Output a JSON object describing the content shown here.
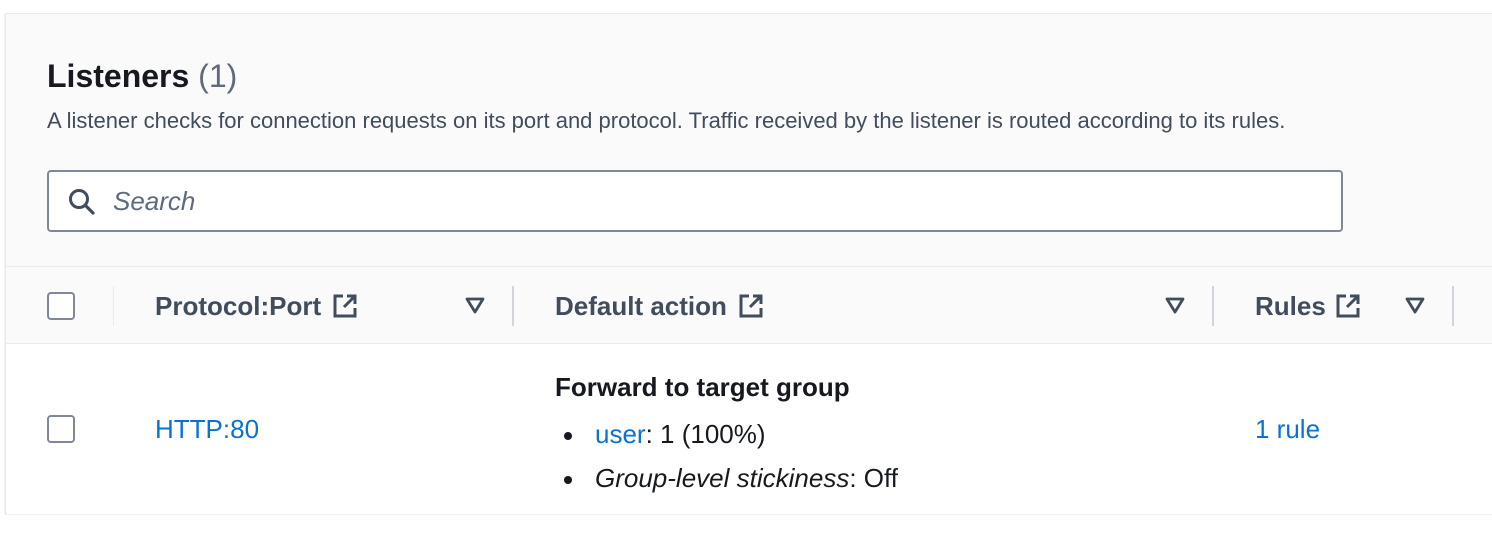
{
  "header": {
    "title": "Listeners",
    "count": "(1)",
    "description": "A listener checks for connection requests on its port and protocol. Traffic received by the listener is routed according to its rules."
  },
  "search": {
    "placeholder": "Search",
    "value": ""
  },
  "columns": [
    {
      "label": "Protocol:Port",
      "icons": [
        "external-link-icon",
        "sort-icon"
      ]
    },
    {
      "label": "Default action",
      "icons": [
        "external-link-icon",
        "sort-icon"
      ]
    },
    {
      "label": "Rules",
      "icons": [
        "external-link-icon",
        "sort-icon"
      ]
    }
  ],
  "rows": [
    {
      "selected": false,
      "protocol_port": "HTTP:80",
      "default_action": {
        "title": "Forward to target group",
        "target_group": "user",
        "target_weight": ": 1 (100%)",
        "stickiness_label": "Group-level stickiness",
        "stickiness_value": ": Off"
      },
      "rules": "1 rule"
    }
  ],
  "colors": {
    "link": "#0972d3",
    "text": "#16191f",
    "header_text": "#414d5c",
    "muted": "#5f6b7a",
    "border": "#7d8998",
    "panel_bg": "#fafafa"
  }
}
